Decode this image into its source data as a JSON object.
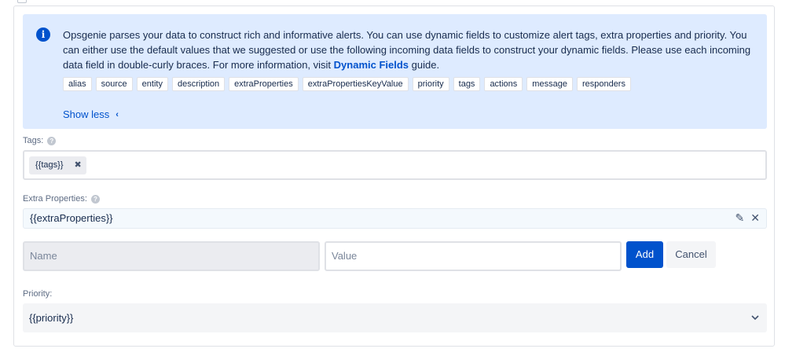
{
  "info_banner": {
    "text_part1": "Opsgenie parses your data to construct rich and informative alerts. You can use dynamic fields to customize alert tags, extra properties and priority. You can either use the default values that we suggested or use the following incoming data fields to construct your dynamic fields. Please use each incoming data field in double-curly braces. For more information, visit ",
    "link_label": "Dynamic Fields",
    "text_part2": " guide.",
    "fields": [
      "alias",
      "source",
      "entity",
      "description",
      "extraProperties",
      "extraPropertiesKeyValue",
      "priority",
      "tags",
      "actions",
      "message",
      "responders"
    ],
    "show_less_label": "Show less"
  },
  "tags": {
    "label": "Tags:",
    "chips": [
      "{{tags}}"
    ]
  },
  "extra_properties": {
    "label": "Extra Properties:",
    "value": "{{extraProperties}}",
    "name_placeholder": "Name",
    "value_placeholder": "Value",
    "add_label": "Add",
    "cancel_label": "Cancel"
  },
  "priority": {
    "label": "Priority:",
    "value": "{{priority}}"
  },
  "colors": {
    "accent": "#0052cc",
    "info_bg": "#deebff"
  },
  "icons": {
    "info": "info-icon",
    "help": "help-icon",
    "remove": "close-icon",
    "edit": "pencil-icon",
    "dropdown": "chevron-down-icon",
    "collapse": "chevron-left-icon"
  }
}
